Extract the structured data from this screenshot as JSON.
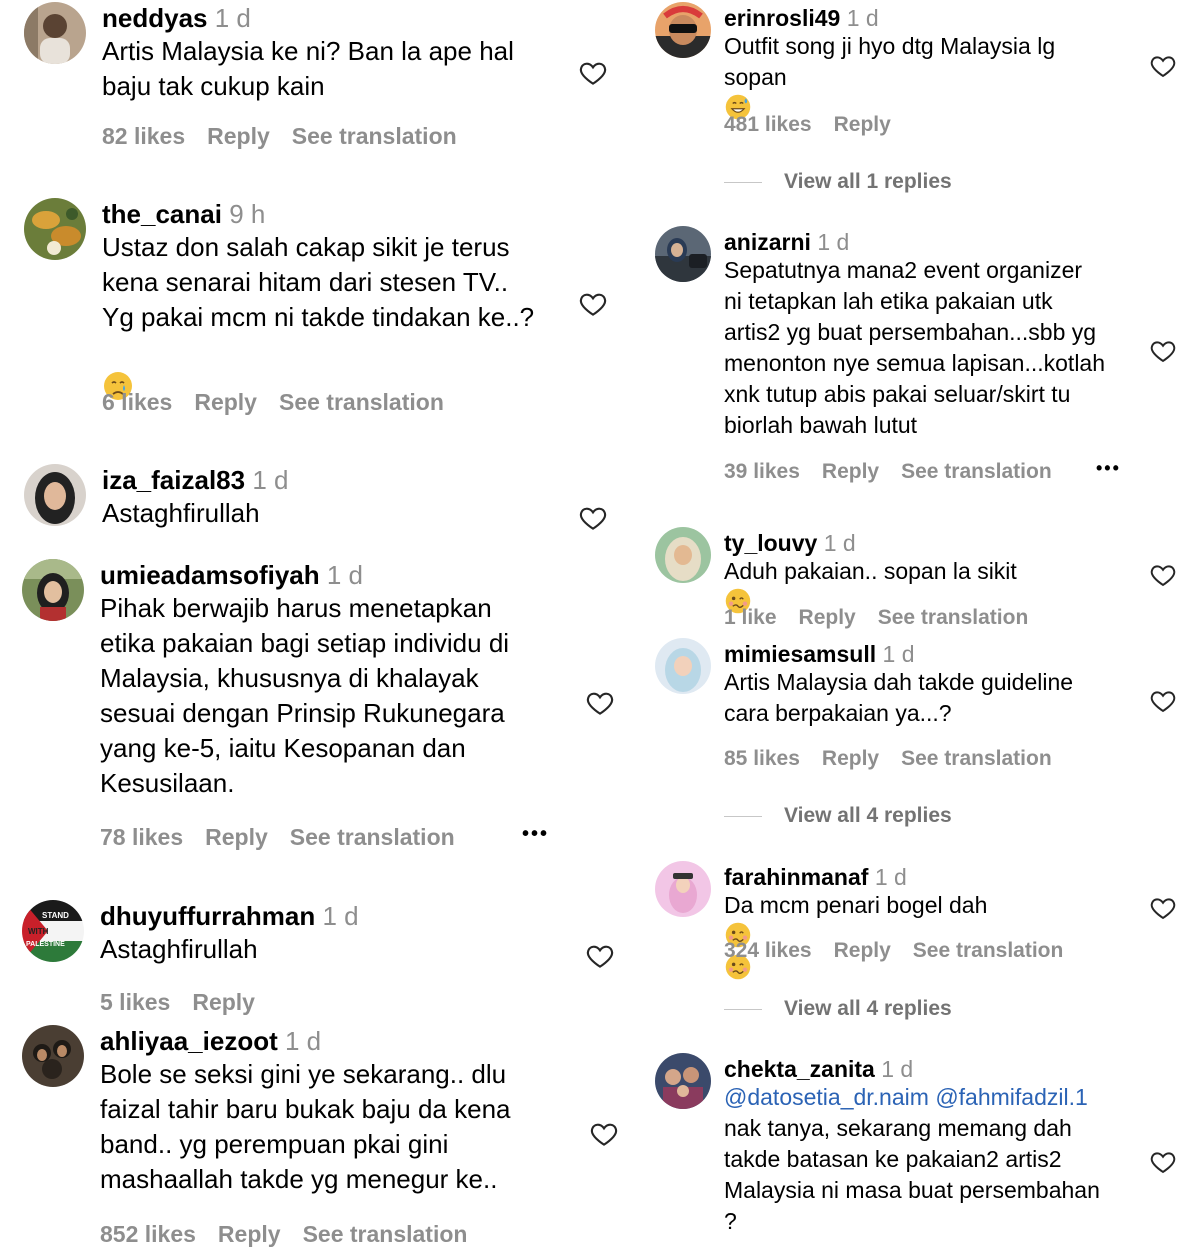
{
  "ui": {
    "more_label": "•••",
    "heart_color": "#262626",
    "meta_color": "#8e8e8e",
    "mention_color": "#2b63b5"
  },
  "left": [
    {
      "username": "neddyas",
      "time": "1 d",
      "lines": [
        "Artis Malaysia ke ni? Ban la ape hal",
        "baju tak cukup kain"
      ],
      "likes": "82 likes",
      "reply": "Reply",
      "translation": "See translation"
    },
    {
      "username": "the_canai",
      "time": "9 h",
      "lines": [
        "Ustaz don salah cakap sikit je terus",
        "kena senarai hitam dari stesen TV..",
        "Yg pakai mcm ni takde tindakan ke..?"
      ],
      "emoji": "crying-face",
      "likes": "6 likes",
      "reply": "Reply",
      "translation": "See translation"
    },
    {
      "username": "iza_faizal83",
      "time": "1 d",
      "lines": [
        "Astaghfirullah"
      ]
    },
    {
      "username": "umieadamsofiyah",
      "time": "1 d",
      "lines": [
        "Pihak berwajib harus menetapkan",
        "etika pakaian bagi setiap individu di",
        "Malaysia, khususnya di khalayak",
        "sesuai dengan Prinsip Rukunegara",
        "yang ke-5, iaitu Kesopanan dan",
        "Kesusilaan."
      ],
      "likes": "78 likes",
      "reply": "Reply",
      "translation": "See translation"
    },
    {
      "username": "dhuyuffurrahman",
      "time": "1 d",
      "lines": [
        "Astaghfirullah"
      ],
      "likes": "5 likes",
      "reply": "Reply",
      "avatar_text": [
        "STAND",
        "WITH",
        "PALESTINE"
      ]
    },
    {
      "username": "ahliyaa_iezoot",
      "time": "1 d",
      "lines": [
        "Bole se seksi gini ye sekarang.. dlu",
        "faizal tahir baru bukak baju da kena",
        "band.. yg perempuan pkai gini",
        "mashaallah takde yg menegur ke.."
      ],
      "likes": "852 likes",
      "reply": "Reply",
      "translation": "See translation"
    }
  ],
  "right": [
    {
      "username": "erinrosli49",
      "time": "1 d",
      "lines": [
        "Outfit song ji hyo dtg Malaysia lg",
        "sopan"
      ],
      "emoji": "grinning-sweat-face",
      "likes": "481 likes",
      "reply": "Reply",
      "view_replies": "View all 1 replies"
    },
    {
      "username": "anizarni",
      "time": "1 d",
      "lines": [
        "Sepatutnya mana2 event organizer",
        "ni tetapkan lah etika pakaian utk",
        "artis2 yg buat persembahan...sbb yg",
        "menonton nye semua lapisan...kotlah",
        "xnk tutup abis pakai seluar/skirt tu",
        "biorlah bawah lutut"
      ],
      "likes": "39 likes",
      "reply": "Reply",
      "translation": "See translation"
    },
    {
      "username": "ty_louvy",
      "time": "1 d",
      "lines": [
        "Aduh pakaian.. sopan la sikit"
      ],
      "emoji": "woozy-face",
      "likes": "1 like",
      "reply": "Reply",
      "translation": "See translation"
    },
    {
      "username": "mimiesamsull",
      "time": "1 d",
      "lines": [
        "Artis Malaysia dah takde guideline",
        "cara berpakaian ya...?"
      ],
      "likes": "85 likes",
      "reply": "Reply",
      "translation": "See translation",
      "view_replies": "View all 4 replies"
    },
    {
      "username": "farahinmanaf",
      "time": "1 d",
      "lines": [
        "Da mcm penari bogel dah"
      ],
      "emoji": "woozy-face",
      "likes": "324 likes",
      "reply": "Reply",
      "translation": "See translation",
      "view_replies": "View all 4 replies"
    },
    {
      "username": "chekta_zanita",
      "time": "1 d",
      "mentions": [
        "@datosetia_dr.naim",
        "@fahmifadzil.1"
      ],
      "lines": [
        "nak tanya, sekarang memang dah",
        "takde batasan ke pakaian2 artis2",
        "Malaysia ni masa buat persembahan",
        "?"
      ]
    }
  ]
}
